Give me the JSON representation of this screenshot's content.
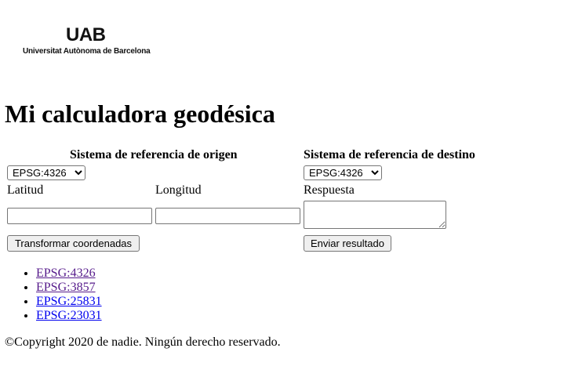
{
  "logo": {
    "mark": "UAB",
    "text": "Universitat Autònoma de Barcelona"
  },
  "page_title": "Mi calculadora geodésica",
  "origin": {
    "header": "Sistema de referencia de origen",
    "crs_selected": "EPSG:4326",
    "crs_options": [
      "EPSG:4326"
    ],
    "lat_label": "Latitud",
    "lon_label": "Longitud",
    "lat_value": "",
    "lon_value": "",
    "transform_button": "Transformar coordenadas"
  },
  "destination": {
    "header": "Sistema de referencia de destino",
    "crs_selected": "EPSG:4326",
    "crs_options": [
      "EPSG:4326"
    ],
    "answer_label": "Respuesta",
    "answer_value": "",
    "send_button": "Enviar resultado"
  },
  "epsg_links": [
    {
      "label": "EPSG:4326",
      "visited": true
    },
    {
      "label": "EPSG:3857",
      "visited": true
    },
    {
      "label": "EPSG:25831",
      "visited": false
    },
    {
      "label": "EPSG:23031",
      "visited": false
    }
  ],
  "footer": "©Copyright 2020 de nadie. Ningún derecho reservado.",
  "colors": {
    "link": "#0000ee",
    "link_visited": "#551a8b",
    "button_bg": "#efefef",
    "border": "#767676"
  }
}
